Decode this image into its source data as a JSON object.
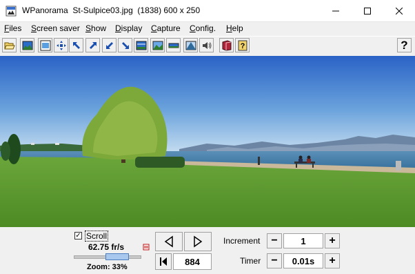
{
  "window": {
    "title": "WPanorama  St-Sulpice03.jpg  (1838) 600 x 250"
  },
  "menu": {
    "items": [
      {
        "label": "Files",
        "u": "F",
        "rest": "iles"
      },
      {
        "label": "Screen saver",
        "u": "S",
        "rest": "creen saver"
      },
      {
        "label": "Show",
        "u": "S",
        "rest": "how"
      },
      {
        "label": "Display",
        "u": "D",
        "rest": "isplay"
      },
      {
        "label": "Capture",
        "u": "C",
        "rest": "apture"
      },
      {
        "label": "Config.",
        "u": "C",
        "rest": "onfig."
      },
      {
        "label": "Help",
        "u": "H",
        "rest": "elp"
      }
    ]
  },
  "toolbar": {
    "help_label": "?"
  },
  "controls": {
    "scroll_label": "Scroll",
    "scroll_checked": true,
    "fps": "62.75 fr/s",
    "zoom_text": "Zoom: 33%",
    "zoom_percent": 33,
    "position_value": "884",
    "increment_label": "Increment",
    "increment_value": "1",
    "timer_label": "Timer",
    "timer_value": "0.01s",
    "minus": "−",
    "plus": "+"
  },
  "colors": {
    "sky_top": "#2a63c6",
    "sky_bottom": "#b9d6ee",
    "grass": "#5b9a2e",
    "lake": "#3f7ca8"
  }
}
